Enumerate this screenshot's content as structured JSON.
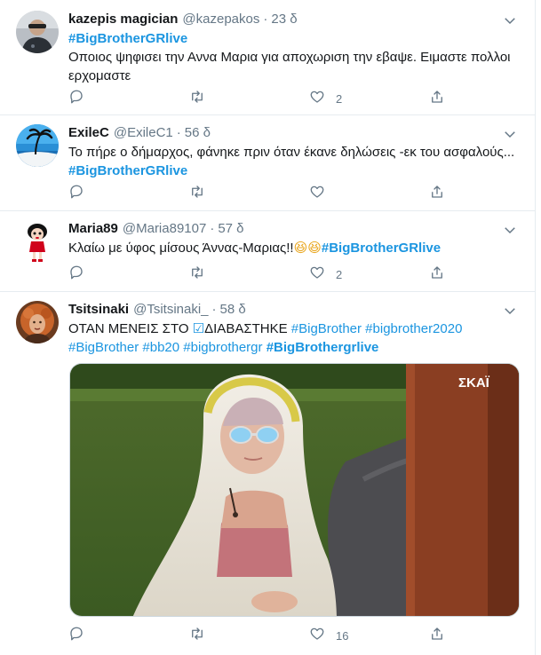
{
  "tweets": [
    {
      "name": "kazepis magician",
      "handle": "@kazepakos",
      "dot": "·",
      "time": "23 δ",
      "hashtag": "#BigBrotherGRlive",
      "text": "Οποιος ψηφισει την Αννα Μαρια για αποχωριση την εβαψε. Ειμαστε πολλοι ερχομαστε",
      "likes": "2"
    },
    {
      "name": "ExileC",
      "handle": "@ExileC1",
      "dot": "·",
      "time": "56 δ",
      "text": "Το πήρε ο δήμαρχος, φάνηκε πριν όταν έκανε δηλώσεις -εκ του ασφαλούς... ",
      "hashtag": "#BigBrotherGRlive",
      "likes": ""
    },
    {
      "name": "Maria89",
      "handle": "@Maria89107",
      "dot": "·",
      "time": "57 δ",
      "text": "Κλαίω με ύφος μίσους Άννας-Μαριας!!",
      "emoji": "😆😆",
      "hashtag": "#BigBrotherGRlive",
      "likes": "2"
    },
    {
      "name": "Tsitsinaki",
      "handle": "@Tsitsinaki_",
      "dot": "·",
      "time": "58 δ",
      "text_a": "ΟΤΑΝ ΜΕΝΕΙΣ ΣΤΟ ",
      "check": "☑",
      "text_b": "ΔΙΑΒΑΣΤΗΚΕ ",
      "tags": [
        "#BigBrother",
        "#bigbrother2020",
        "#BigBrother",
        "#bb20",
        "#bigbrothergr"
      ],
      "bold_tag": "#BigBrothergrlive",
      "media_watermark": "ΣΚΑΪ",
      "likes": "16"
    }
  ],
  "colors": {
    "link": "#1b95e0",
    "secondary": "#657786",
    "border": "#e6ecf0"
  },
  "icons": [
    "reply-icon",
    "retweet-icon",
    "like-icon",
    "share-icon",
    "chevron-down-icon"
  ]
}
